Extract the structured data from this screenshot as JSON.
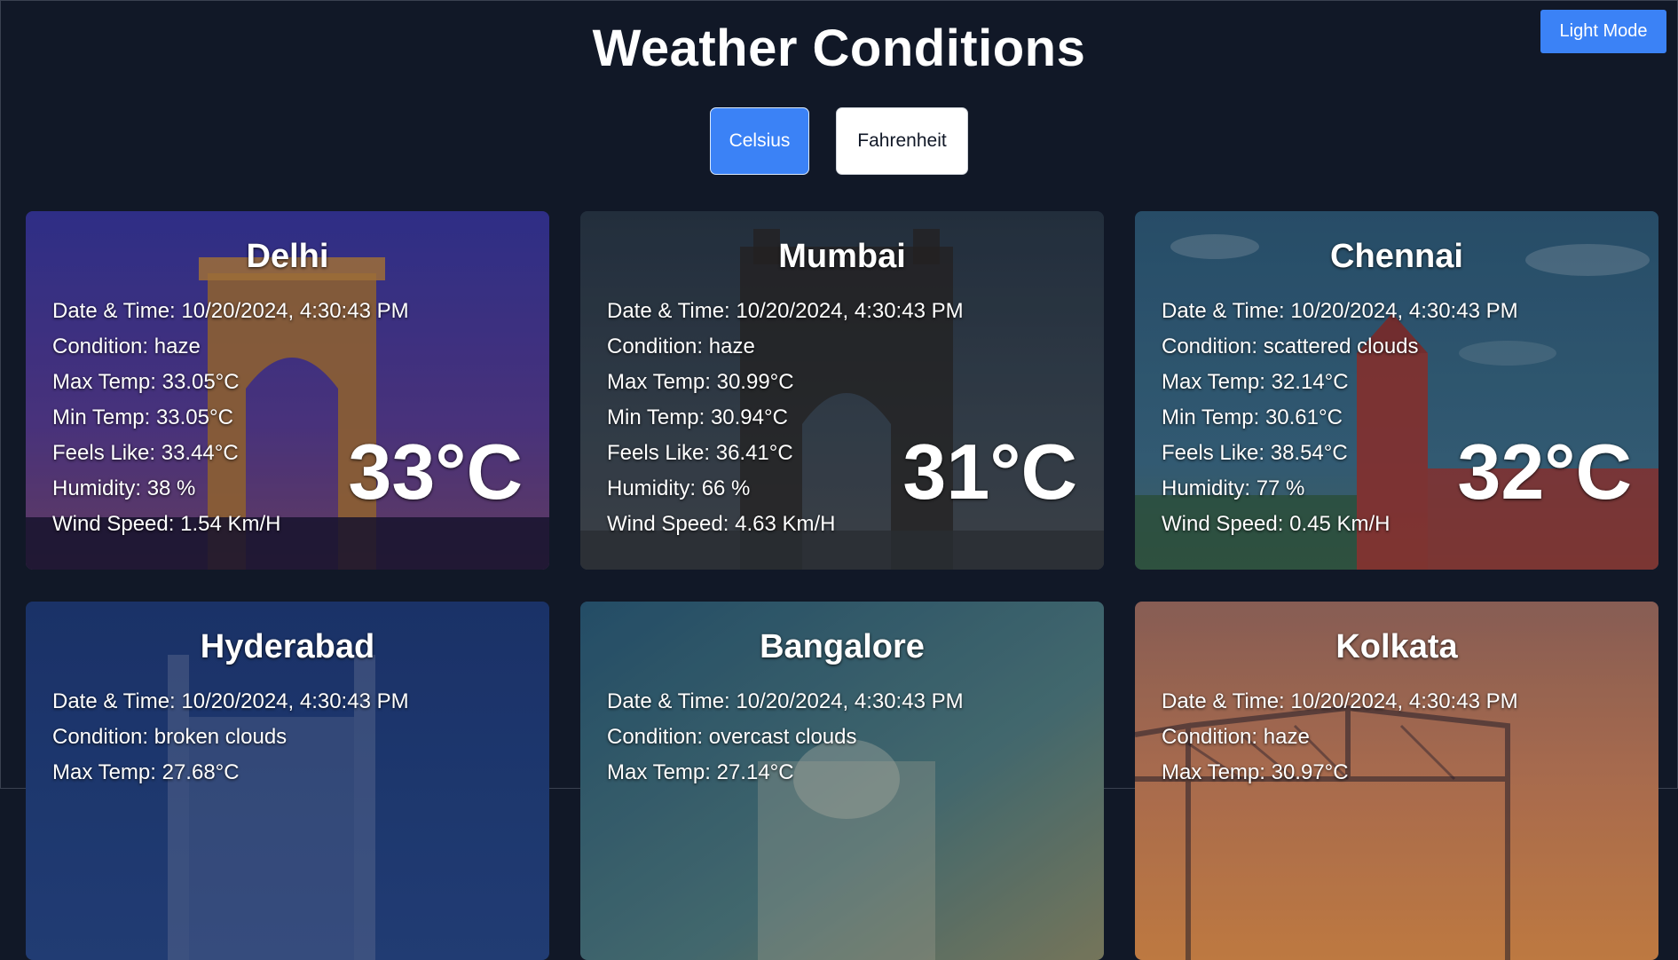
{
  "header": {
    "title": "Weather Conditions",
    "mode_button_label": "Light Mode"
  },
  "units": {
    "celsius_label": "Celsius",
    "fahrenheit_label": "Fahrenheit",
    "selected": "Celsius"
  },
  "labels": {
    "datetime": "Date & Time: ",
    "condition": "Condition: ",
    "max_temp": "Max Temp: ",
    "min_temp": "Min Temp: ",
    "feels_like": "Feels Like: ",
    "humidity": "Humidity: ",
    "wind_speed": "Wind Speed: "
  },
  "colors": {
    "page_bg": "#111827",
    "accent": "#3b82f6"
  },
  "cities": [
    {
      "name": "Delhi",
      "datetime": "10/20/2024, 4:30:43 PM",
      "condition": "haze",
      "max_temp": "33.05°C",
      "min_temp": "33.05°C",
      "feels_like": "33.44°C",
      "humidity": "38 %",
      "wind_speed": "1.54 Km/H",
      "temp": "33°C",
      "bg_image": "india-gate-at-dusk"
    },
    {
      "name": "Mumbai",
      "datetime": "10/20/2024, 4:30:43 PM",
      "condition": "haze",
      "max_temp": "30.99°C",
      "min_temp": "30.94°C",
      "feels_like": "36.41°C",
      "humidity": "66 %",
      "wind_speed": "4.63 Km/H",
      "temp": "31°C",
      "bg_image": "gateway-of-india"
    },
    {
      "name": "Chennai",
      "datetime": "10/20/2024, 4:30:43 PM",
      "condition": "scattered clouds",
      "max_temp": "32.14°C",
      "min_temp": "30.61°C",
      "feels_like": "38.54°C",
      "humidity": "77 %",
      "wind_speed": "0.45 Km/H",
      "temp": "32°C",
      "bg_image": "chennai-central-station"
    },
    {
      "name": "Hyderabad",
      "datetime": "10/20/2024, 4:30:43 PM",
      "condition": "broken clouds",
      "max_temp": "27.68°C",
      "bg_image": "charminar-at-night"
    },
    {
      "name": "Bangalore",
      "datetime": "10/20/2024, 4:30:43 PM",
      "condition": "overcast clouds",
      "max_temp": "27.14°C",
      "bg_image": "vidhana-soudha"
    },
    {
      "name": "Kolkata",
      "datetime": "10/20/2024, 4:30:43 PM",
      "condition": "haze",
      "max_temp": "30.97°C",
      "bg_image": "howrah-bridge-at-sunset"
    }
  ]
}
